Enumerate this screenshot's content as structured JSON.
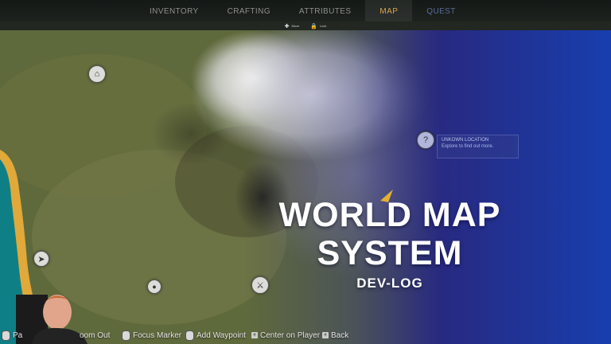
{
  "topbar": {
    "tabs": [
      {
        "label": "INVENTORY"
      },
      {
        "label": "CRAFTING"
      },
      {
        "label": "ATTRIBUTES"
      },
      {
        "label": "MAP"
      },
      {
        "label": "QUEST"
      }
    ],
    "active_tab": "MAP"
  },
  "subbar": {
    "items": [
      {
        "icon": "move-icon",
        "label": "Move"
      },
      {
        "icon": "lock-icon",
        "label": "Lock"
      }
    ]
  },
  "map": {
    "markers": [
      {
        "icon": "home-icon"
      },
      {
        "icon": "unknown-location-icon"
      },
      {
        "icon": "fish-icon"
      },
      {
        "icon": "waypoint-pin-icon"
      },
      {
        "icon": "crossed-swords-icon"
      }
    ],
    "info": {
      "title": "UNKOWN LOCATION",
      "description": "Explore to find out more."
    }
  },
  "overlay": {
    "line1": "WORLD MAP",
    "line2": "SYSTEM",
    "line3": "DEV-LOG"
  },
  "controls": [
    {
      "label": "Pa"
    },
    {
      "label": "oom Out"
    },
    {
      "label": "Focus Marker"
    },
    {
      "label": "Add Waypoint"
    },
    {
      "label": "Center on Player"
    },
    {
      "label": "Back"
    }
  ],
  "colors": {
    "accent": "#d6a64a",
    "grass": "#5d6a3a",
    "water": "#0f7f86",
    "sand": "#e0a93a",
    "fog_blue": "#1c3fb0"
  }
}
